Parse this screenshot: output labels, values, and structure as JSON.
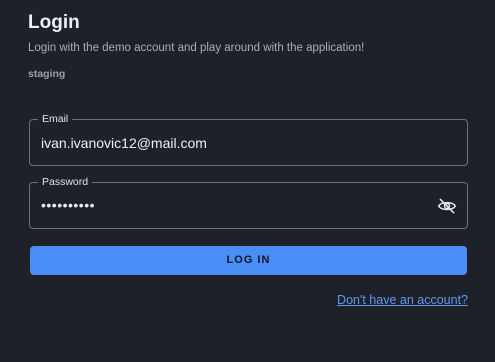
{
  "header": {
    "title": "Login",
    "subtitle": "Login with the demo account and play around with the application!",
    "environment": "staging"
  },
  "form": {
    "email": {
      "label": "Email",
      "value": "ivan.ivanovic12@mail.com"
    },
    "password": {
      "label": "Password",
      "masked_value": "••••••••••",
      "toggle_icon": "eye-off-icon"
    },
    "submit_label": "LOG IN",
    "signup_link": "Don't have an account?"
  },
  "colors": {
    "background": "#1f2129",
    "accent": "#4a8ef7",
    "link": "#5b98f4",
    "border": "#6b707c"
  }
}
